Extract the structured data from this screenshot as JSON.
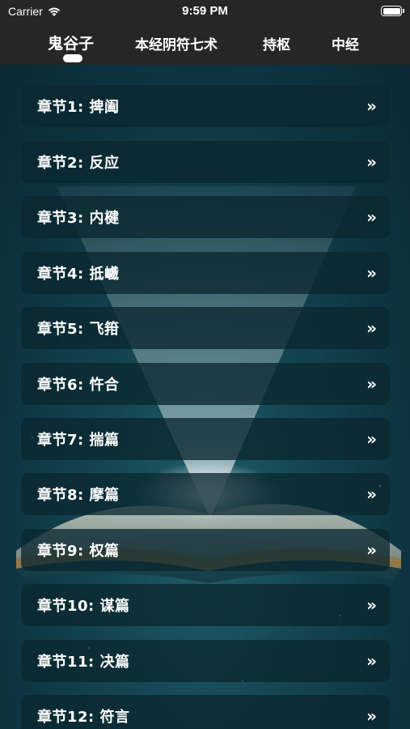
{
  "status": {
    "carrier": "Carrier",
    "time": "9:59 PM"
  },
  "tabs": [
    {
      "label": "鬼谷子",
      "selected": true
    },
    {
      "label": "本经阴符七术",
      "selected": false
    },
    {
      "label": "持枢",
      "selected": false
    },
    {
      "label": "中经",
      "selected": false
    }
  ],
  "chapters": [
    "章节1: 捭阖",
    "章节2: 反应",
    "章节3: 内楗",
    "章节4: 抵巇",
    "章节5: 飞箝",
    "章节6: 忤合",
    "章节7: 揣篇",
    "章节8: 摩篇",
    "章节9: 权篇",
    "章节10: 谋篇",
    "章节11: 决篇",
    "章节12: 符言"
  ],
  "chevron_glyph": "»",
  "colors": {
    "topbar": "#262626",
    "background": "#0d3440",
    "row": "#0a2830",
    "text": "#ffffff"
  }
}
